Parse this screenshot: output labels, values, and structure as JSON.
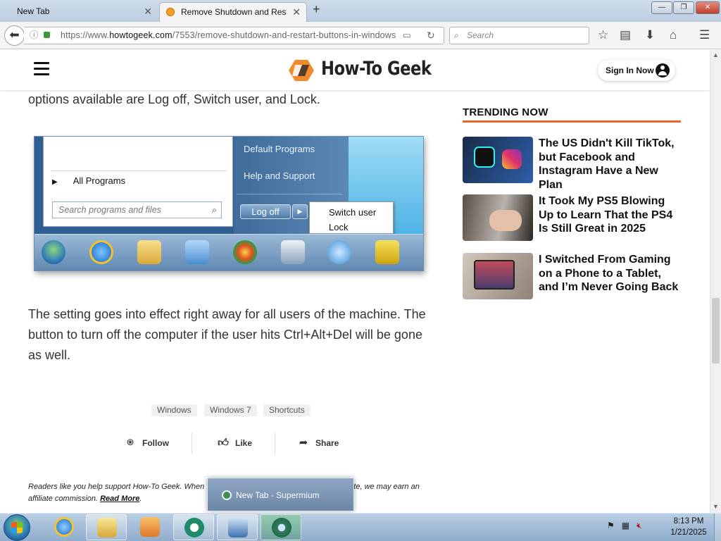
{
  "browser": {
    "tabs": [
      {
        "label": "New Tab",
        "active": false
      },
      {
        "label": "Remove Shutdown and Rest",
        "active": true
      }
    ],
    "url": {
      "prefix": "https://www.",
      "domain": "howtogeek.com",
      "path": "/7553/remove-shutdown-and-restart-buttons-in-windows"
    },
    "search_placeholder": "Search",
    "window_controls": {
      "minimize": "—",
      "maximize": "❐",
      "close": "✕"
    }
  },
  "site": {
    "logo_text": "How-To Geek",
    "signin_label": "Sign In Now",
    "brand_color": "#e8642a"
  },
  "article": {
    "top_text": "options available are Log off, Switch user, and Lock.",
    "figure": {
      "all_programs": "All Programs",
      "search_placeholder": "Search programs and files",
      "links": [
        "Default Programs",
        "Help and Support"
      ],
      "logoff": "Log off",
      "popup_items": [
        "Switch user",
        "Lock"
      ]
    },
    "body_text": "The setting goes into effect right away for all users of the machine. The button to turn off the computer if the user hits Ctrl+Alt+Del will be gone as well.",
    "tags": [
      "Windows",
      "Windows 7",
      "Shortcuts"
    ],
    "actions": {
      "follow": "Follow",
      "like": "Like",
      "share": "Share"
    },
    "disclaimer_before": "Readers like you help support How-To Geek. When",
    "disclaimer_after": "te, we may earn an affiliate commission.",
    "disclaimer_link": "Read More"
  },
  "sidebar": {
    "title": "TRENDING NOW",
    "items": [
      {
        "title": "The US Didn't Kill TikTok, but Facebook and Instagram Have a New Plan",
        "icon": "tiktok-instagram-thumbnail"
      },
      {
        "title": "It Took My PS5 Blowing Up to Learn That the PS4 Is Still Great in 2025",
        "icon": "ps4-thumbnail"
      },
      {
        "title": "I Switched From Gaming on a Phone to a Tablet, and I’m Never Going Back",
        "icon": "tablet-thumbnail"
      }
    ]
  },
  "taskbar": {
    "hover_popup": "New Tab - Supermium",
    "clock_time": "8:13 PM",
    "clock_date": "1/21/2025"
  }
}
